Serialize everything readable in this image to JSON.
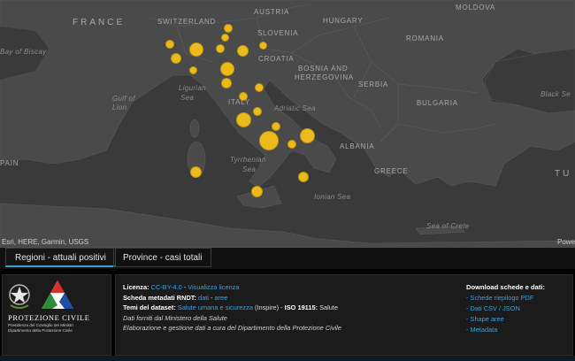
{
  "map": {
    "countries": [
      {
        "name": "FRANCE",
        "big": true
      },
      {
        "name": "SWITZERLAND"
      },
      {
        "name": "AUSTRIA"
      },
      {
        "name": "HUNGARY"
      },
      {
        "name": "MOLDOVA"
      },
      {
        "name": "SLOVENIA"
      },
      {
        "name": "CROATIA"
      },
      {
        "name": "ROMANIA"
      },
      {
        "name": "BOSNIA AND"
      },
      {
        "name": "HERZEGOVINA"
      },
      {
        "name": "SERBIA"
      },
      {
        "name": "BULGARIA"
      },
      {
        "name": "ITALY"
      },
      {
        "name": "ALBANIA"
      },
      {
        "name": "GREECE"
      },
      {
        "name": "PAIN"
      },
      {
        "name": "TU"
      }
    ],
    "seas": [
      "Bay of Biscay",
      "Gulf of",
      "Lion",
      "Ligurian",
      "Sea",
      "Adriatic Sea",
      "Tyrrhenian",
      "Sea",
      "Ionian Sea",
      "Sea of Crete",
      "Black Se"
    ],
    "attribution": "Esri, HERE, Garmin, USGS",
    "powered": "Powe",
    "dot_color": "#f4c21a"
  },
  "tabs": [
    {
      "label": "Regioni - attuali positivi",
      "active": true
    },
    {
      "label": "Province - casi totali",
      "active": false
    }
  ],
  "logo": {
    "title": "PROTEZIONE CIVILE",
    "sub1": "Presidenza del Consiglio dei Ministri",
    "sub2": "Dipartimento della Protezione Civile"
  },
  "info": {
    "license_label": "Licenza:",
    "license_link": "CC-BY-4.0",
    "license_sep": " - ",
    "license_view": "Visualizza licenza",
    "metadata_label": "Scheda metadati RNDT:",
    "metadata_dati": "dati",
    "metadata_sep": " - ",
    "metadata_aree": "aree",
    "themes_label": "Temi del dataset:",
    "themes_link": "Salute umana e sicurezza",
    "themes_rest": " (Inspire) - ",
    "iso_label": "ISO 19115:",
    "iso_value": " Salute",
    "line4": "Dati forniti dal Ministero della Salute",
    "line5": "Elaborazione e gestione dati a cura del Dipartimento della Protezione Civile"
  },
  "downloads": {
    "heading": "Download schede e dati:",
    "items": [
      "Schede riepilogo PDF",
      "Dati CSV / JSON",
      "Shape aree",
      "Metadata"
    ]
  }
}
